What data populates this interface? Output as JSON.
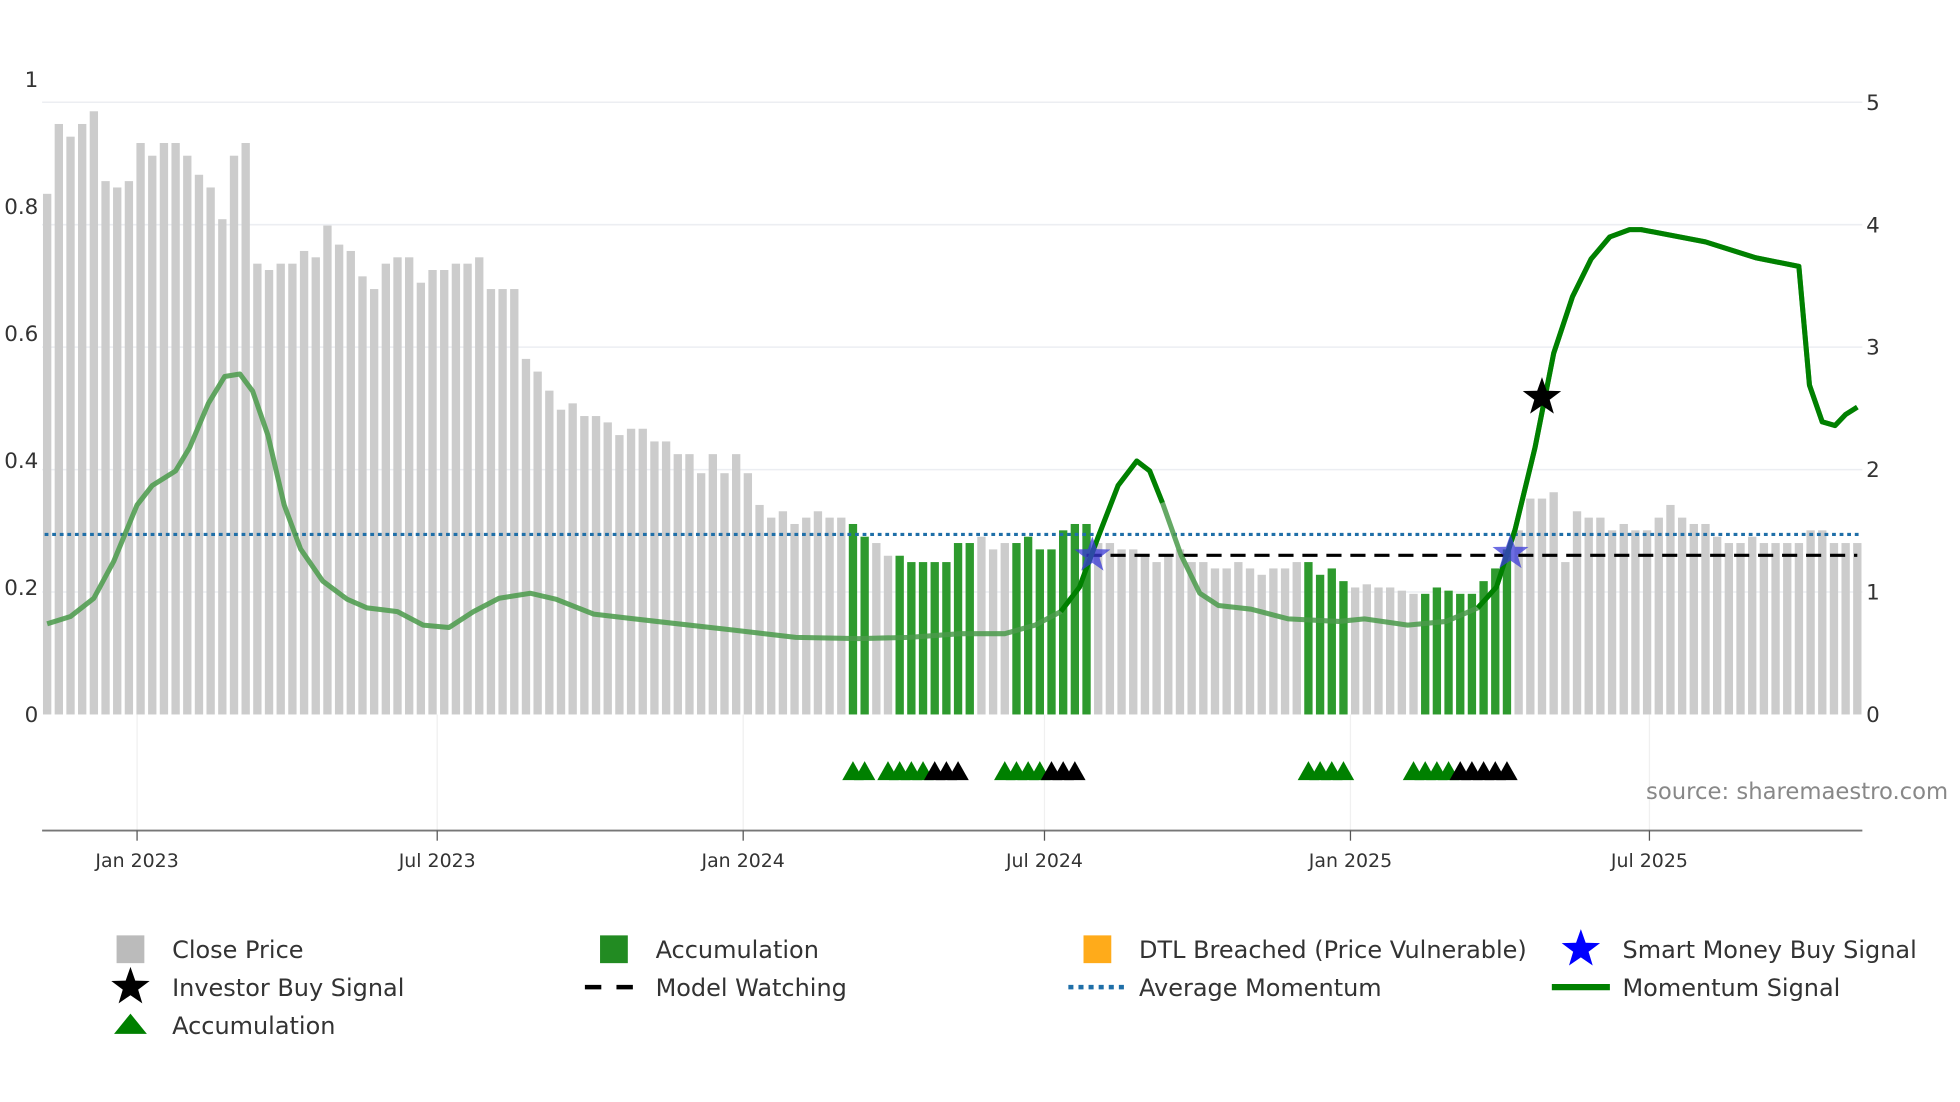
{
  "chart_data": {
    "type": "bar",
    "title": "",
    "left_axis": {
      "ticks": [
        "0",
        "0.2",
        "0.4",
        "0.6",
        "0.8",
        "1"
      ],
      "ylim": [
        0,
        1
      ]
    },
    "right_axis": {
      "ticks": [
        "0",
        "1",
        "2",
        "3",
        "4",
        "5"
      ],
      "ylim": [
        0,
        5
      ]
    },
    "x_ticks": [
      {
        "label": "Jan 2023",
        "bar_index": 7.7
      },
      {
        "label": "Jul 2023",
        "bar_index": 33.4
      },
      {
        "label": "Jan 2024",
        "bar_index": 59.6
      },
      {
        "label": "Jul 2024",
        "bar_index": 85.4
      },
      {
        "label": "Jan 2025",
        "bar_index": 111.6
      },
      {
        "label": "Jul 2025",
        "bar_index": 137.2
      }
    ],
    "close": [
      0.82,
      0.93,
      0.91,
      0.93,
      0.95,
      0.84,
      0.83,
      0.84,
      0.9,
      0.88,
      0.9,
      0.9,
      0.88,
      0.85,
      0.83,
      0.78,
      0.88,
      0.9,
      0.71,
      0.7,
      0.71,
      0.71,
      0.73,
      0.72,
      0.77,
      0.74,
      0.73,
      0.69,
      0.67,
      0.71,
      0.72,
      0.72,
      0.68,
      0.7,
      0.7,
      0.71,
      0.71,
      0.72,
      0.67,
      0.67,
      0.67,
      0.56,
      0.54,
      0.51,
      0.48,
      0.49,
      0.47,
      0.47,
      0.46,
      0.44,
      0.45,
      0.45,
      0.43,
      0.43,
      0.41,
      0.41,
      0.38,
      0.41,
      0.38,
      0.41,
      0.38,
      0.33,
      0.31,
      0.32,
      0.3,
      0.31,
      0.32,
      0.31,
      0.31,
      0.3,
      0.28,
      0.27,
      0.25,
      0.25,
      0.24,
      0.24,
      0.24,
      0.24,
      0.27,
      0.27,
      0.28,
      0.26,
      0.27,
      0.27,
      0.28,
      0.26,
      0.26,
      0.29,
      0.3,
      0.3,
      0.27,
      0.27,
      0.26,
      0.26,
      0.25,
      0.24,
      0.25,
      0.26,
      0.24,
      0.24,
      0.23,
      0.23,
      0.24,
      0.23,
      0.22,
      0.23,
      0.23,
      0.24,
      0.24,
      0.22,
      0.23,
      0.21,
      0.2,
      0.205,
      0.2,
      0.2,
      0.195,
      0.19,
      0.19,
      0.2,
      0.195,
      0.19,
      0.19,
      0.21,
      0.23,
      0.26,
      0.29,
      0.34,
      0.34,
      0.35,
      0.24,
      0.32,
      0.31,
      0.31,
      0.29,
      0.3,
      0.29,
      0.29,
      0.31,
      0.33,
      0.31,
      0.3,
      0.3,
      0.28,
      0.27,
      0.27,
      0.28,
      0.27,
      0.27,
      0.27,
      0.27,
      0.29,
      0.29,
      0.27,
      0.27,
      0.27
    ],
    "accumulation_bars": [
      69,
      70,
      73,
      74,
      75,
      76,
      77,
      78,
      79,
      83,
      84,
      85,
      86,
      87,
      88,
      89,
      108,
      109,
      110,
      111,
      118,
      119,
      120,
      121,
      122,
      123,
      124,
      125
    ],
    "momentum": [
      [
        0,
        0.74
      ],
      [
        2,
        0.8
      ],
      [
        4,
        0.95
      ],
      [
        5.7,
        1.25
      ],
      [
        7.7,
        1.71
      ],
      [
        9,
        1.87
      ],
      [
        11,
        1.99
      ],
      [
        12.2,
        2.18
      ],
      [
        13.8,
        2.54
      ],
      [
        15.2,
        2.76
      ],
      [
        16.5,
        2.78
      ],
      [
        17.6,
        2.64
      ],
      [
        18.9,
        2.28
      ],
      [
        20.3,
        1.71
      ],
      [
        21.7,
        1.35
      ],
      [
        23.6,
        1.09
      ],
      [
        25.7,
        0.94
      ],
      [
        27.4,
        0.87
      ],
      [
        30,
        0.84
      ],
      [
        32.2,
        0.73
      ],
      [
        34.4,
        0.71
      ],
      [
        36.5,
        0.84
      ],
      [
        38.7,
        0.95
      ],
      [
        41.4,
        0.99
      ],
      [
        43.6,
        0.94
      ],
      [
        46.8,
        0.82
      ],
      [
        52.2,
        0.76
      ],
      [
        58.7,
        0.69
      ],
      [
        64.1,
        0.63
      ],
      [
        69.5,
        0.62
      ],
      [
        73.8,
        0.63
      ],
      [
        78.2,
        0.66
      ],
      [
        82,
        0.66
      ],
      [
        84.6,
        0.73
      ],
      [
        86.8,
        0.84
      ],
      [
        88.4,
        1.04
      ],
      [
        90,
        1.45
      ],
      [
        91.7,
        1.87
      ],
      [
        93.3,
        2.07
      ],
      [
        94.4,
        1.99
      ],
      [
        95.5,
        1.73
      ],
      [
        97.1,
        1.3
      ],
      [
        98.7,
        0.99
      ],
      [
        100.3,
        0.89
      ],
      [
        103.1,
        0.86
      ],
      [
        106.3,
        0.78
      ],
      [
        110.6,
        0.76
      ],
      [
        112.8,
        0.78
      ],
      [
        116.5,
        0.73
      ],
      [
        119.8,
        0.76
      ],
      [
        122.5,
        0.87
      ],
      [
        124.1,
        1.04
      ],
      [
        125.7,
        1.51
      ],
      [
        127.4,
        2.18
      ],
      [
        129,
        2.95
      ],
      [
        130.6,
        3.41
      ],
      [
        132.2,
        3.72
      ],
      [
        133.8,
        3.9
      ],
      [
        135.5,
        3.96
      ],
      [
        136.5,
        3.96
      ],
      [
        142,
        3.86
      ],
      [
        146.3,
        3.73
      ],
      [
        150,
        3.66
      ],
      [
        150.9,
        2.69
      ],
      [
        152,
        2.39
      ],
      [
        153.1,
        2.36
      ],
      [
        154,
        2.45
      ],
      [
        155,
        2.51
      ]
    ],
    "momentum_active_ranges": [
      [
        86,
        97
      ],
      [
        122,
        155
      ]
    ],
    "average_momentum": 1.47,
    "model_watching": {
      "value": 1.3,
      "from": 89,
      "to": 155
    },
    "smart_money_buy": [
      [
        89.5,
        1.3
      ],
      [
        125.3,
        1.32
      ]
    ],
    "investor_buy": [
      [
        128,
        2.59
      ]
    ],
    "triangles": {
      "green": [
        69,
        70,
        72,
        73,
        74,
        75,
        82,
        83,
        84,
        85,
        108,
        109,
        110,
        111,
        117,
        118,
        119,
        120
      ],
      "black": [
        76,
        77,
        78,
        86,
        87,
        88,
        121,
        122,
        123,
        124,
        125
      ]
    },
    "source": "source: sharemaestro.com",
    "legend": [
      {
        "label": "Close Price",
        "symbol": "bar",
        "color": "#bbbbbb"
      },
      {
        "label": "Accumulation",
        "symbol": "bar",
        "color": "#228b22"
      },
      {
        "label": "DTL Breached (Price Vulnerable)",
        "symbol": "bar",
        "color": "#ffab1a"
      },
      {
        "label": "Smart Money Buy Signal",
        "symbol": "star",
        "color": "#0000ff"
      },
      {
        "label": "Investor Buy Signal",
        "symbol": "star",
        "color": "#000000"
      },
      {
        "label": "Model Watching",
        "symbol": "dash",
        "color": "#000000"
      },
      {
        "label": "Average Momentum",
        "symbol": "dot",
        "color": "#1f6fa8"
      },
      {
        "label": "Momentum Signal",
        "symbol": "line",
        "color": "#008000"
      },
      {
        "label": "Accumulation",
        "symbol": "triangle",
        "color": "#008000"
      }
    ]
  }
}
